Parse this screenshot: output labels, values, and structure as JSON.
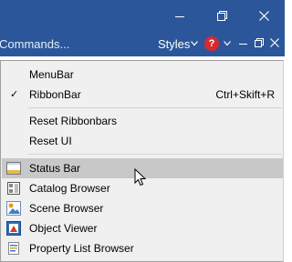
{
  "ribbon": {
    "commands_label": "Commands...",
    "styles_label": "Styles"
  },
  "icons": {
    "minimize": "minimize-icon",
    "restore": "restore-icon",
    "close": "close-icon",
    "help": "help-icon",
    "chevron": "chevron-down-icon"
  },
  "colors": {
    "titlebar": "#2b579a",
    "menu_bg": "#f0f0f0",
    "highlight": "#c8c8c8",
    "help": "#d9282f"
  },
  "menu": {
    "items": [
      {
        "label": "MenuBar",
        "checked": false,
        "shortcut": ""
      },
      {
        "label": "RibbonBar",
        "checked": true,
        "shortcut": "Ctrl+Skift+R"
      },
      {
        "label": "Reset Ribbonbars"
      },
      {
        "label": "Reset UI"
      },
      {
        "label": "Status Bar",
        "icon": "status-bar-icon",
        "highlighted": true
      },
      {
        "label": "Catalog Browser",
        "icon": "catalog-browser-icon"
      },
      {
        "label": "Scene Browser",
        "icon": "scene-browser-icon"
      },
      {
        "label": "Object Viewer",
        "icon": "object-viewer-icon"
      },
      {
        "label": "Property List Browser",
        "icon": "property-list-browser-icon"
      }
    ],
    "check_glyph": "✓"
  }
}
